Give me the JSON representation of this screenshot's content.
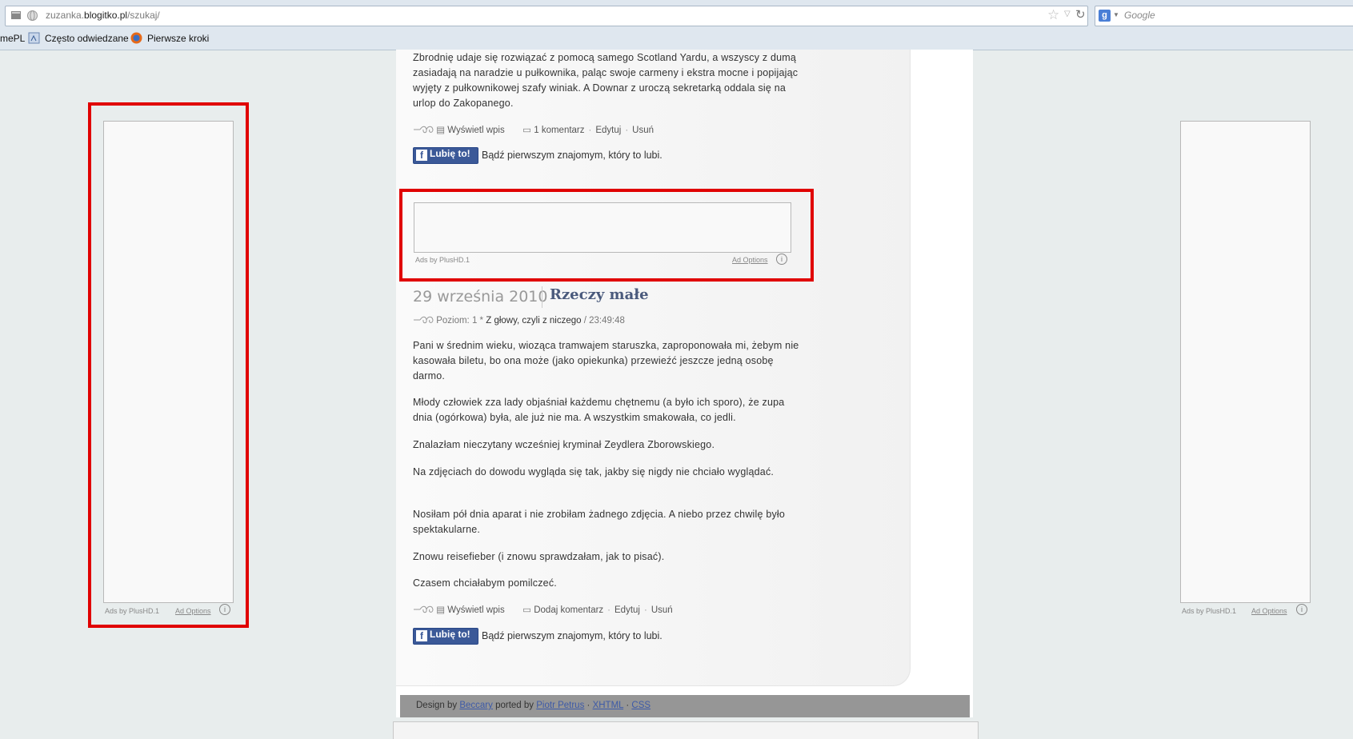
{
  "browser": {
    "url_prefix": "zuzanka.",
    "url_domain": "blogitko.pl",
    "url_path": "/szukaj/",
    "search_placeholder": "Google",
    "bookmarks": [
      "mePL",
      "Często odwiedzane",
      "Pierwsze kroki"
    ]
  },
  "post1": {
    "text": "Zbrodnię udaje się rozwiązać z pomocą samego Scotland Yardu, a wszyscy z dumą zasiadają na naradzie u pułkownika, paląc swoje carmeny i ekstra mocne i popijając wyjęty z pułkownikowej szafy winiak. A Downar z uroczą sekretarką oddala się na urlop do Zakopanego.",
    "links": [
      "Wyświetl wpis",
      "1 komentarz",
      "Edytuj",
      "Usuń"
    ],
    "like_button": "Lubię to!",
    "like_text": "Bądź pierwszym znajomym, który to lubi."
  },
  "ad_middle": {
    "ads_by": "Ads by PlusHD.1",
    "ad_options": "Ad Options"
  },
  "ad_left": {
    "ads_by": "Ads by PlusHD.1",
    "ad_options": "Ad Options"
  },
  "ad_right": {
    "ads_by": "Ads by PlusHD.1",
    "ad_options": "Ad Options"
  },
  "post2": {
    "date": "29 września 2010",
    "title": "Rzeczy małe",
    "meta_level": "Poziom: 1",
    "meta_star": "*",
    "meta_category": "Z głowy, czyli z niczego",
    "meta_time": "/ 23:49:48",
    "paragraphs": [
      "Pani w średnim wieku, wioząca tramwajem staruszka, zaproponowała mi, żebym nie kasowała biletu, bo ona może (jako opiekunka) przewieźć jeszcze jedną osobę darmo.",
      "Młody człowiek zza lady objaśniał każdemu chętnemu (a było ich sporo), że zupa dnia (ogórkowa) była, ale już nie ma. A wszystkim smakowała, co jedli.",
      "Znalazłam nieczytany wcześniej kryminał Zeydlera Zborowskiego.",
      "Na zdjęciach do dowodu wygląda się tak, jakby się nigdy nie chciało wyglądać.",
      "Nosiłam pół dnia aparat i nie zrobiłam żadnego zdjęcia. A niebo przez chwilę było spektakularne.",
      "Znowu reisefieber (i znowu sprawdzałam, jak to pisać).",
      "Czasem chciałabym pomilczeć."
    ],
    "links": [
      "Wyświetl wpis",
      "Dodaj komentarz",
      "Edytuj",
      "Usuń"
    ],
    "like_button": "Lubię to!",
    "like_text": "Bądź pierwszym znajomym, który to lubi."
  },
  "footer": {
    "design_by": "Design by",
    "beccary": "Beccary",
    "ported_by": "ported by",
    "author": "Piotr Petrus",
    "xhtml": "XHTML",
    "css": "CSS",
    "sep": "·"
  },
  "colors": {
    "highlight": "#e00000",
    "facebook": "#3b5998",
    "title": "#4a5a7c"
  }
}
